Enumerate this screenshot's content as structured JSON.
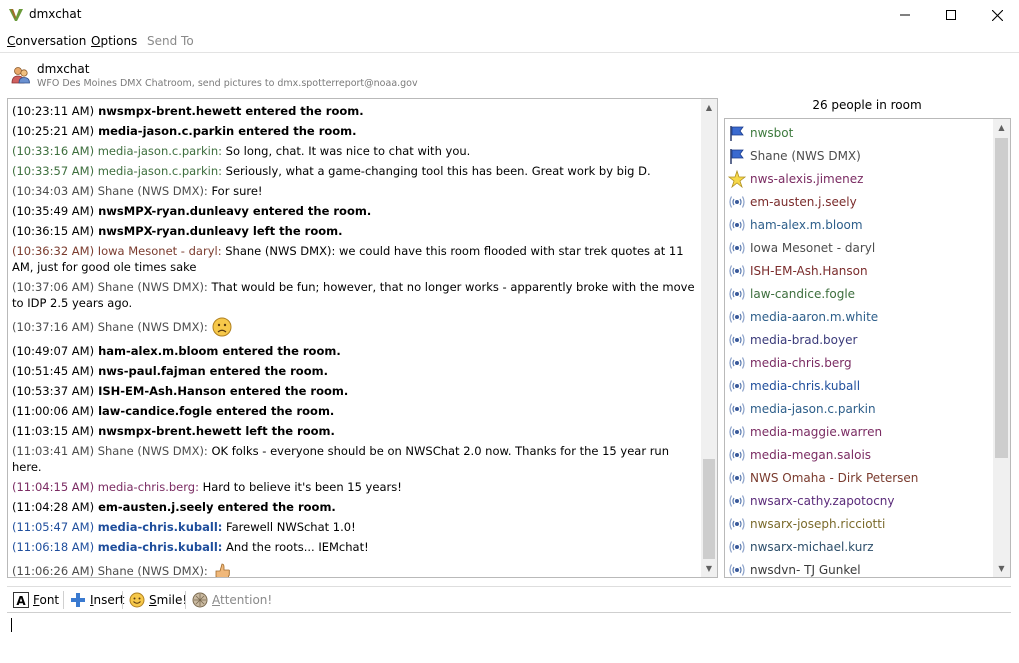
{
  "window": {
    "title": "dmxchat"
  },
  "menu": {
    "conversation": {
      "first": "C",
      "rest": "onversation"
    },
    "options": {
      "first": "O",
      "rest": "ptions"
    },
    "send_to": "Send To"
  },
  "header": {
    "title": "dmxchat",
    "subtitle": "WFO Des Moines DMX Chatroom, send pictures to dmx.spotterreport@noaa.gov"
  },
  "colors": {
    "shane": "#4d4d4d",
    "media_jason": "#3d6e3d",
    "iowa": "#7a3b2e",
    "media_chris_berg": "#7a2b62",
    "media_chris_kuball": "#1f4e9c",
    "sys": "#000000"
  },
  "messages": [
    {
      "kind": "sys",
      "time": "(10:23:11 AM)",
      "text": "nwsmpx-brent.hewett entered the room."
    },
    {
      "kind": "sys",
      "time": "(10:25:21 AM)",
      "text": "media-jason.c.parkin entered the room."
    },
    {
      "kind": "chat",
      "time": "(10:33:16 AM) media-jason.c.parkin:",
      "text": "So long, chat. It was nice to chat with you.",
      "color": "#3d6e3d"
    },
    {
      "kind": "chat",
      "time": "(10:33:57 AM) media-jason.c.parkin:",
      "text": "Seriously, what a game-changing tool this has been. Great work by big D.",
      "color": "#3d6e3d"
    },
    {
      "kind": "chat",
      "time": "(10:34:03 AM) Shane (NWS DMX):",
      "text": "For sure!",
      "color": "#4d4d4d"
    },
    {
      "kind": "sys",
      "time": "(10:35:49 AM)",
      "text": "nwsMPX-ryan.dunleavy entered the room."
    },
    {
      "kind": "sys",
      "time": "(10:36:15 AM)",
      "text": "nwsMPX-ryan.dunleavy left the room."
    },
    {
      "kind": "chat",
      "time": "(10:36:32 AM) Iowa Mesonet - daryl:",
      "text": "Shane (NWS DMX): we could have this room flooded with star trek quotes at 11 AM, just for good ole times sake",
      "color": "#7a3b2e"
    },
    {
      "kind": "chat",
      "time": "(10:37:06 AM) Shane (NWS DMX):",
      "text": "That would be fun; however, that no longer works - apparently broke with the move to IDP 2.5 years ago.",
      "color": "#4d4d4d"
    },
    {
      "kind": "emoticon",
      "time": "(10:37:16 AM) Shane (NWS DMX):",
      "text": "",
      "emote": "sad",
      "color": "#4d4d4d"
    },
    {
      "kind": "sys",
      "time": "(10:49:07 AM)",
      "text": "ham-alex.m.bloom entered the room."
    },
    {
      "kind": "sys",
      "time": "(10:51:45 AM)",
      "text": "nws-paul.fajman entered the room."
    },
    {
      "kind": "sys",
      "time": "(10:53:37 AM)",
      "text": "ISH-EM-Ash.Hanson entered the room."
    },
    {
      "kind": "sys",
      "time": "(11:00:06 AM)",
      "text": "law-candice.fogle entered the room."
    },
    {
      "kind": "sys",
      "time": "(11:03:15 AM)",
      "text": "nwsmpx-brent.hewett left the room."
    },
    {
      "kind": "chat",
      "time": "(11:03:41 AM) Shane (NWS DMX):",
      "text": "OK folks - everyone should be on NWSChat 2.0 now.  Thanks for the 15 year run here.",
      "color": "#4d4d4d"
    },
    {
      "kind": "chat",
      "time": "(11:04:15 AM) media-chris.berg:",
      "text": "Hard to believe it's been 15 years!",
      "color": "#7a2b62"
    },
    {
      "kind": "sys",
      "time": "(11:04:28 AM)",
      "text": "em-austen.j.seely entered the room."
    },
    {
      "kind": "chatbold",
      "time": "(11:05:47 AM)",
      "who": "media-chris.kuball:",
      "text": "Farewell NWSchat 1.0!",
      "color": "#1f4e9c"
    },
    {
      "kind": "chatbold",
      "time": "(11:06:18 AM)",
      "who": "media-chris.kuball:",
      "text": "And the roots... IEMchat!",
      "color": "#1f4e9c"
    },
    {
      "kind": "emoticon",
      "time": "(11:06:26 AM) Shane (NWS DMX):",
      "text": "",
      "emote": "thumb",
      "color": "#4d4d4d"
    }
  ],
  "roster": {
    "count_label": "26 people in room",
    "items": [
      {
        "name": "nwsbot",
        "icon": "flag-icon",
        "color": "#3d7a3d"
      },
      {
        "name": "Shane (NWS DMX)",
        "icon": "flag-icon",
        "color": "#4d4d4d"
      },
      {
        "name": "nws-alexis.jimenez",
        "icon": "star-icon",
        "color": "#7a2b62"
      },
      {
        "name": "em-austen.j.seely",
        "icon": "broadcast-icon",
        "color": "#7a2b2b"
      },
      {
        "name": "ham-alex.m.bloom",
        "icon": "broadcast-icon",
        "color": "#2d5e8a"
      },
      {
        "name": "Iowa Mesonet - daryl",
        "icon": "broadcast-icon",
        "color": "#4d4d4d"
      },
      {
        "name": "ISH-EM-Ash.Hanson",
        "icon": "broadcast-icon",
        "color": "#7a2b2b"
      },
      {
        "name": "law-candice.fogle",
        "icon": "broadcast-icon",
        "color": "#3d6e3d"
      },
      {
        "name": "media-aaron.m.white",
        "icon": "broadcast-icon",
        "color": "#2d5e8a"
      },
      {
        "name": "media-brad.boyer",
        "icon": "broadcast-icon",
        "color": "#3a3a7a"
      },
      {
        "name": "media-chris.berg",
        "icon": "broadcast-icon",
        "color": "#7a2b62"
      },
      {
        "name": "media-chris.kuball",
        "icon": "broadcast-icon",
        "color": "#1f4e9c"
      },
      {
        "name": "media-jason.c.parkin",
        "icon": "broadcast-icon",
        "color": "#2d5e8a"
      },
      {
        "name": "media-maggie.warren",
        "icon": "broadcast-icon",
        "color": "#7a2b62"
      },
      {
        "name": "media-megan.salois",
        "icon": "broadcast-icon",
        "color": "#7a2b62"
      },
      {
        "name": "NWS Omaha - Dirk Petersen",
        "icon": "broadcast-icon",
        "color": "#7a3b2e"
      },
      {
        "name": "nwsarx-cathy.zapotocny",
        "icon": "broadcast-icon",
        "color": "#5a2b7a"
      },
      {
        "name": "nwsarx-joseph.ricciotti",
        "icon": "broadcast-icon",
        "color": "#7a6a2b"
      },
      {
        "name": "nwsarx-michael.kurz",
        "icon": "broadcast-icon",
        "color": "#2d4e6a"
      },
      {
        "name": "nwsdvn- TJ Gunkel",
        "icon": "broadcast-icon",
        "color": "#3a3a3a"
      }
    ]
  },
  "toolbar": {
    "font": {
      "first": "F",
      "rest": "ont"
    },
    "insert": {
      "first": "I",
      "rest": "nsert"
    },
    "smile": {
      "first": "S",
      "rest": "mile!"
    },
    "attention": {
      "first": "A",
      "rest": "ttention!"
    }
  },
  "input": {
    "value": ""
  }
}
